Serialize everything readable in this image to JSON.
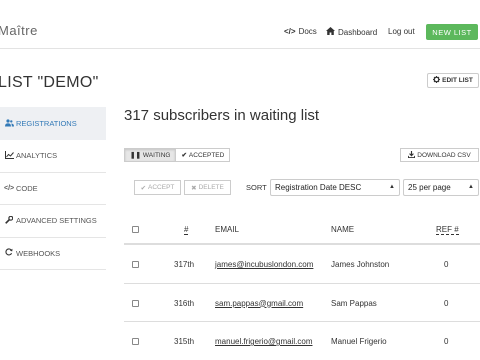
{
  "header": {
    "brand": "Maître",
    "docs": "Docs",
    "dashboard": "Dashboard",
    "logout": "Log out",
    "new_list": "NEW LIST"
  },
  "page": {
    "title": "LIST \"DEMO\"",
    "edit_list": "EDIT LIST"
  },
  "sidebar": {
    "items": [
      {
        "label": "REGISTRATIONS",
        "icon": "users-icon",
        "active": true
      },
      {
        "label": "ANALYTICS",
        "icon": "chart-icon",
        "active": false
      },
      {
        "label": "CODE",
        "icon": "code-icon",
        "active": false
      },
      {
        "label": "ADVANCED SETTINGS",
        "icon": "wrench-icon",
        "active": false
      },
      {
        "label": "WEBHOOKS",
        "icon": "refresh-icon",
        "active": false
      }
    ]
  },
  "main": {
    "title": "317 subscribers in waiting list",
    "tabs": {
      "waiting": "WAITING",
      "accepted": "ACCEPTED"
    },
    "download_csv": "DOWNLOAD CSV",
    "accept": "ACCEPT",
    "delete": "DELETE",
    "sort_label": "SORT",
    "sort_value": "Registration Date DESC",
    "per_page": "25 per page"
  },
  "table": {
    "headers": {
      "position": "#",
      "email": "EMAIL",
      "name": "NAME",
      "ref": "REF #"
    },
    "rows": [
      {
        "position": "317th",
        "email": "james@incubuslondon.com",
        "name": "James Johnston",
        "ref": "0"
      },
      {
        "position": "316th",
        "email": "sam.pappas@gmail.com",
        "name": "Sam Pappas",
        "ref": "0"
      },
      {
        "position": "315th",
        "email": "manuel.frigerio@gmail.com",
        "name": "Manuel Frigerio",
        "ref": "0"
      }
    ]
  },
  "colors": {
    "accent": "#337ab7",
    "new_list_bg": "#5cb85c",
    "active_sidebar_bg": "#eef0f3"
  }
}
